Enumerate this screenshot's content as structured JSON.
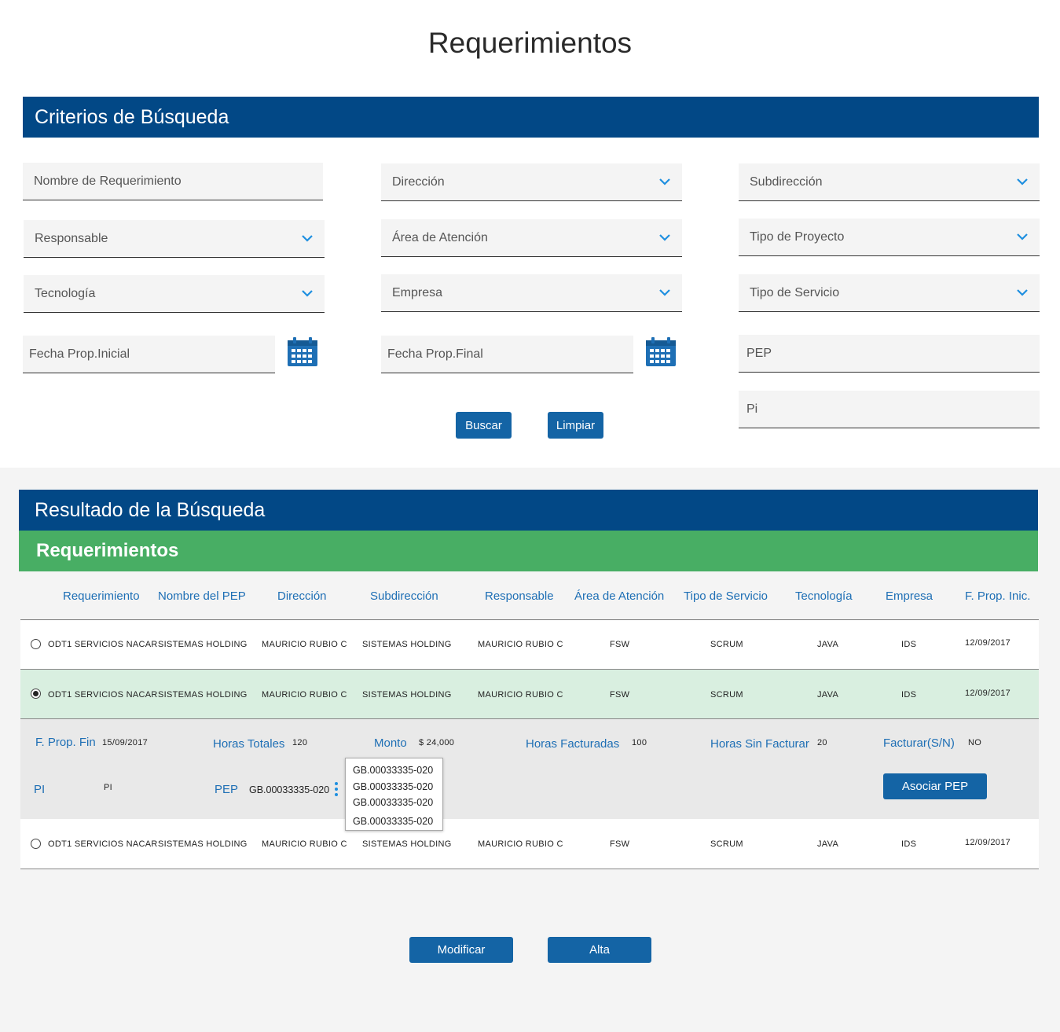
{
  "page": {
    "title": "Requerimientos"
  },
  "search": {
    "header": "Criterios de Búsqueda",
    "fields": {
      "nombre_requerimiento": "Nombre de Requerimiento",
      "direccion": "Dirección",
      "subdireccion": "Subdirección",
      "responsable": "Responsable",
      "area_atencion": "Área de Atención",
      "tipo_proyecto": "Tipo de Proyecto",
      "tecnologia": "Tecnología",
      "empresa": "Empresa",
      "tipo_servicio": "Tipo de Servicio",
      "fecha_inicial": "Fecha Prop.Inicial",
      "fecha_final": "Fecha Prop.Final",
      "pep": "PEP",
      "pi": "Pi"
    },
    "buttons": {
      "buscar": "Buscar",
      "limpiar": "Limpiar"
    },
    "icons": {
      "dropdown": "chevron-down-icon",
      "date": "calendar-icon"
    }
  },
  "results": {
    "header": "Resultado de la Búsqueda",
    "section_title": "Requerimientos",
    "columns": [
      "Requerimiento",
      "Nombre del PEP",
      "Dirección",
      "Subdirección",
      "Responsable",
      "Área de Atención",
      "Tipo de Servicio",
      "Tecnología",
      "Empresa",
      "F. Prop. Inic."
    ],
    "rows": [
      {
        "selected": false,
        "requerimiento": "ODT1 SERVICIOS NACAR",
        "nombre_pep": "SISTEMAS HOLDING",
        "direccion": "MAURICIO RUBIO C",
        "subdireccion": "SISTEMAS HOLDING",
        "responsable": "MAURICIO RUBIO C",
        "area": "FSW",
        "tipo_servicio": "SCRUM",
        "tecnologia": "JAVA",
        "empresa": "IDS",
        "fecha": "12/09/2017"
      },
      {
        "selected": true,
        "requerimiento": "ODT1 SERVICIOS NACAR",
        "nombre_pep": "SISTEMAS HOLDING",
        "direccion": "MAURICIO RUBIO C",
        "subdireccion": "SISTEMAS HOLDING",
        "responsable": "MAURICIO RUBIO C",
        "area": "FSW",
        "tipo_servicio": "SCRUM",
        "tecnologia": "JAVA",
        "empresa": "IDS",
        "fecha": "12/09/2017"
      },
      {
        "selected": false,
        "requerimiento": "ODT1 SERVICIOS NACAR",
        "nombre_pep": "SISTEMAS HOLDING",
        "direccion": "MAURICIO RUBIO C",
        "subdireccion": "SISTEMAS HOLDING",
        "responsable": "MAURICIO RUBIO C",
        "area": "FSW",
        "tipo_servicio": "SCRUM",
        "tecnologia": "JAVA",
        "empresa": "IDS",
        "fecha": "12/09/2017"
      }
    ],
    "detail": {
      "f_prop_fin_label": "F. Prop. Fin",
      "f_prop_fin_value": "15/09/2017",
      "horas_totales_label": "Horas Totales",
      "horas_totales_value": "120",
      "monto_label": "Monto",
      "monto_value": "$ 24,000",
      "horas_facturadas_label": "Horas Facturadas",
      "horas_facturadas_value": "100",
      "horas_sin_facturar_label": "Horas Sin Facturar",
      "horas_sin_facturar_value": "20",
      "facturar_label": "Facturar(S/N)",
      "facturar_value": "NO",
      "pi_label": "PI",
      "pi_value": "PI",
      "pep_label": "PEP",
      "pep_value": "GB.00033335-020",
      "asociar_pep": "Asociar PEP",
      "pep_options": [
        "GB.00033335-020",
        "GB.00033335-020",
        "GB.00033335-020",
        "GB.00033335-020"
      ]
    },
    "buttons": {
      "modificar": "Modificar",
      "alta": "Alta"
    }
  },
  "colors": {
    "primary": "#024886",
    "button": "#1464a5",
    "green": "#48ae64",
    "link": "#1e6fb5",
    "selected_row": "#d9efe0"
  }
}
